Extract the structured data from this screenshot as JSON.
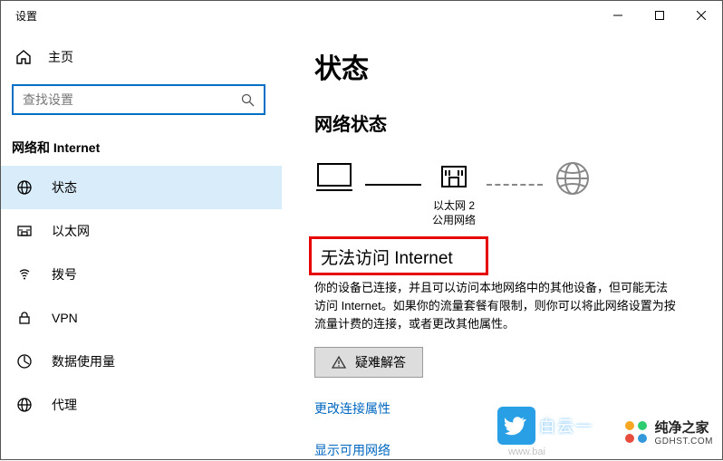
{
  "window": {
    "title": "设置"
  },
  "sidebar": {
    "home": "主页",
    "search_placeholder": "查找设置",
    "category": "网络和 Internet",
    "items": [
      {
        "label": "状态"
      },
      {
        "label": "以太网"
      },
      {
        "label": "拨号"
      },
      {
        "label": "VPN"
      },
      {
        "label": "数据使用量"
      },
      {
        "label": "代理"
      }
    ]
  },
  "main": {
    "title": "状态",
    "subtitle": "网络状态",
    "diagram": {
      "adapter_name": "以太网 2",
      "adapter_type": "公用网络"
    },
    "no_internet": "无法访问 Internet",
    "description": "你的设备已连接，并且可以访问本地网络中的其他设备，但可能无法访问 Internet。如果你的流量套餐有限制，则你可以将此网络设置为按流量计费的连接，或者更改其他属性。",
    "troubleshoot": "疑难解答",
    "links": {
      "change_props": "更改连接属性",
      "show_networks": "显示可用网络"
    }
  },
  "watermarks": {
    "wm1": "白云一",
    "wm2_brand": "纯净之家",
    "wm2_url": "GDHST.COM",
    "baidu": "www.bai"
  }
}
